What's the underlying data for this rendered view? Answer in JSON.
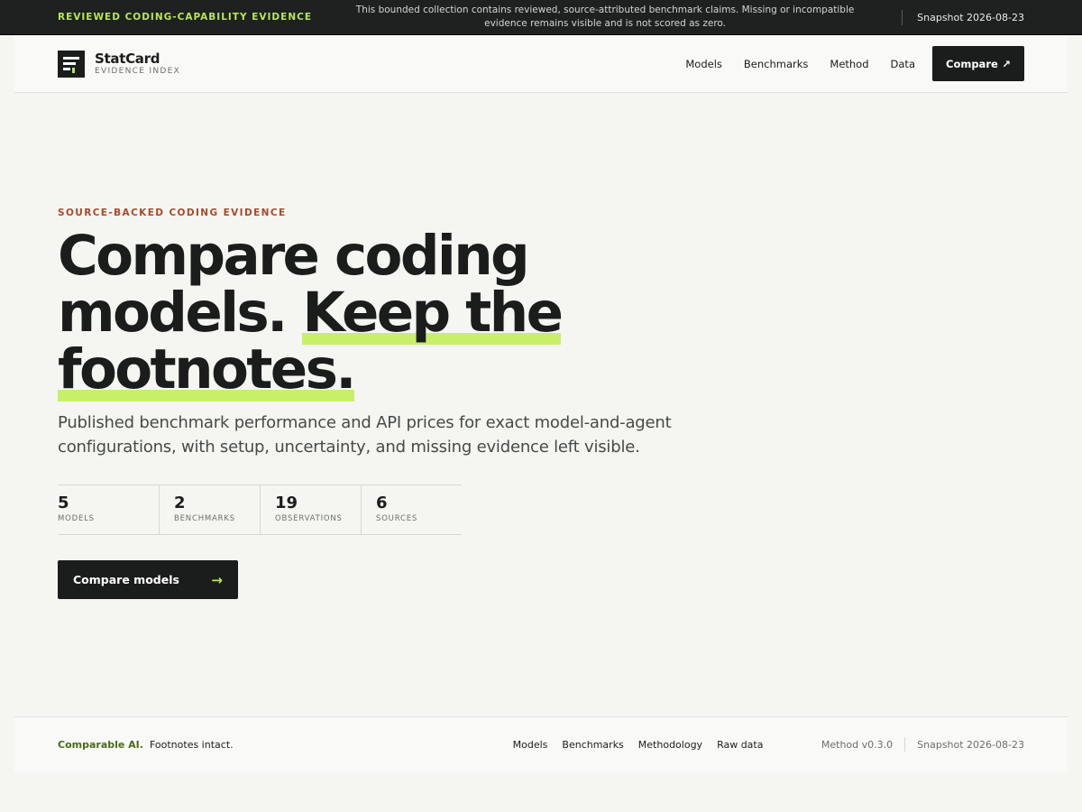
{
  "banner": {
    "tag": "REVIEWED CODING-CAPABILITY EVIDENCE",
    "message": "This bounded collection contains reviewed, source-attributed benchmark claims. Missing or incompatible evidence remains visible and is not scored as zero.",
    "snapshot": "Snapshot 2026-08-23"
  },
  "header": {
    "brand_name": "StatCard",
    "brand_sub": "EVIDENCE INDEX",
    "nav": [
      "Models",
      "Benchmarks",
      "Method",
      "Data"
    ],
    "cta_label": "Compare",
    "cta_icon": "external-arrow-icon"
  },
  "hero": {
    "eyebrow": "SOURCE-BACKED CODING EVIDENCE",
    "title_part1": "Compare coding models.",
    "title_highlight": "Keep the footnotes.",
    "lede": "Published benchmark performance and API prices for exact model-and-agent configurations, with setup, uncertainty, and missing evidence left visible.",
    "stats": [
      {
        "value": "5",
        "label": "MODELS"
      },
      {
        "value": "2",
        "label": "BENCHMARKS"
      },
      {
        "value": "19",
        "label": "OBSERVATIONS"
      },
      {
        "value": "6",
        "label": "SOURCES"
      }
    ],
    "cta_label": "Compare models",
    "cta_icon": "arrow-right-icon"
  },
  "footer": {
    "brand": "Comparable AI.",
    "tagline": "Footnotes intact.",
    "links": [
      "Models",
      "Benchmarks",
      "Methodology",
      "Raw data"
    ],
    "version": "Method v0.3.0",
    "snapshot": "Snapshot 2026-08-23"
  },
  "colors": {
    "accent": "#b8e55a",
    "highlight": "#c8ef6a",
    "eyebrow": "#a9492c",
    "ink": "#1b1d1c",
    "background": "#f5f6f1"
  }
}
